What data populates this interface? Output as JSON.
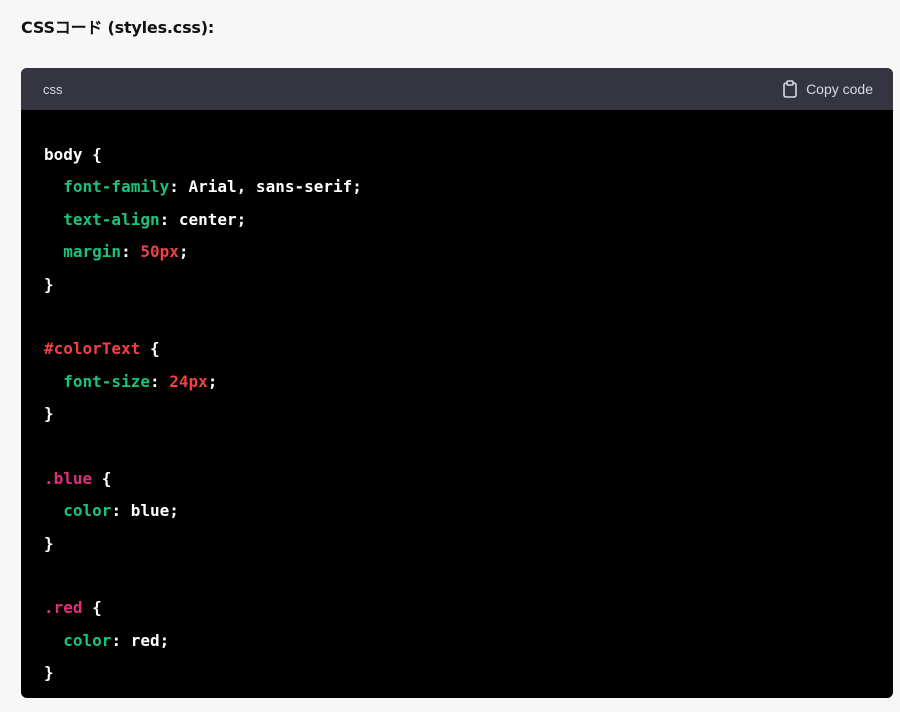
{
  "heading": "CSSコード (styles.css):",
  "code_block": {
    "language": "css",
    "copy_label": "Copy code",
    "copy_icon": "clipboard-icon",
    "colors": {
      "header_bg": "#343541",
      "body_bg": "#000000",
      "property": "#19c37d",
      "number": "#ef4146",
      "selector": "#df3079",
      "plain": "#ffffff"
    },
    "lines": [
      [
        {
          "t": "body {",
          "c": "plain"
        }
      ],
      [
        {
          "t": "  ",
          "c": "plain"
        },
        {
          "t": "font-family",
          "c": "prop"
        },
        {
          "t": ": Arial, sans-serif;",
          "c": "plain"
        }
      ],
      [
        {
          "t": "  ",
          "c": "plain"
        },
        {
          "t": "text-align",
          "c": "prop"
        },
        {
          "t": ": center;",
          "c": "plain"
        }
      ],
      [
        {
          "t": "  ",
          "c": "plain"
        },
        {
          "t": "margin",
          "c": "prop"
        },
        {
          "t": ": ",
          "c": "plain"
        },
        {
          "t": "50px",
          "c": "num"
        },
        {
          "t": ";",
          "c": "plain"
        }
      ],
      [
        {
          "t": "}",
          "c": "plain"
        }
      ],
      [],
      [
        {
          "t": "#colorText",
          "c": "id"
        },
        {
          "t": " {",
          "c": "plain"
        }
      ],
      [
        {
          "t": "  ",
          "c": "plain"
        },
        {
          "t": "font-size",
          "c": "prop"
        },
        {
          "t": ": ",
          "c": "plain"
        },
        {
          "t": "24px",
          "c": "num"
        },
        {
          "t": ";",
          "c": "plain"
        }
      ],
      [
        {
          "t": "}",
          "c": "plain"
        }
      ],
      [],
      [
        {
          "t": ".blue",
          "c": "sel"
        },
        {
          "t": " {",
          "c": "plain"
        }
      ],
      [
        {
          "t": "  ",
          "c": "plain"
        },
        {
          "t": "color",
          "c": "prop"
        },
        {
          "t": ": blue;",
          "c": "plain"
        }
      ],
      [
        {
          "t": "}",
          "c": "plain"
        }
      ],
      [],
      [
        {
          "t": ".red",
          "c": "sel"
        },
        {
          "t": " {",
          "c": "plain"
        }
      ],
      [
        {
          "t": "  ",
          "c": "plain"
        },
        {
          "t": "color",
          "c": "prop"
        },
        {
          "t": ": red;",
          "c": "plain"
        }
      ],
      [
        {
          "t": "}",
          "c": "plain"
        }
      ]
    ]
  }
}
